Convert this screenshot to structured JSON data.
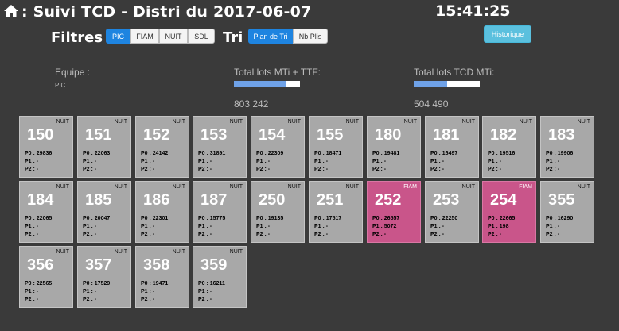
{
  "header": {
    "title": ": Suivi TCD - Distri du 2017-06-07",
    "clock": "15:41:25",
    "home_icon": "home-icon"
  },
  "filters": {
    "label": "Filtres",
    "options": [
      "PIC",
      "FIAM",
      "NUIT",
      "SDL"
    ],
    "active": "PIC"
  },
  "sort": {
    "label": "Tri",
    "options": [
      "Plan de Tri",
      "Nb Plis"
    ],
    "active": "Plan de Tri"
  },
  "historique_label": "Historique",
  "stats": {
    "equipe_label": "Equipe :",
    "equipe_value": "PIC",
    "total_mti_ttf_label": "Total lots MTi + TTF:",
    "total_mti_ttf_value": "803 242",
    "total_mti_ttf_progress": 0.8,
    "total_tcd_mti_label": "Total lots TCD MTi:",
    "total_tcd_mti_value": "504 490",
    "total_tcd_mti_progress": 0.5
  },
  "colors": {
    "background": "#3a3a3a",
    "tile_default": "#a8a8a8",
    "tile_fiam": "#c9558a",
    "accent_blue": "#1e84e0",
    "historique": "#5bc0de"
  },
  "tiles": [
    {
      "num": "150",
      "tag": "NUIT",
      "p0": "P0 : 29836",
      "p1": "P1 : -",
      "p2": "P2 : -"
    },
    {
      "num": "151",
      "tag": "NUIT",
      "p0": "P0 : 22063",
      "p1": "P1 : -",
      "p2": "P2 : -"
    },
    {
      "num": "152",
      "tag": "NUIT",
      "p0": "P0 : 24142",
      "p1": "P1 : -",
      "p2": "P2 : -"
    },
    {
      "num": "153",
      "tag": "NUIT",
      "p0": "P0 : 31891",
      "p1": "P1 : -",
      "p2": "P2 : -"
    },
    {
      "num": "154",
      "tag": "NUIT",
      "p0": "P0 : 22309",
      "p1": "P1 : -",
      "p2": "P2 : -"
    },
    {
      "num": "155",
      "tag": "NUIT",
      "p0": "P0 : 18471",
      "p1": "P1 : -",
      "p2": "P2 : -"
    },
    {
      "num": "180",
      "tag": "NUIT",
      "p0": "P0 : 19481",
      "p1": "P1 : -",
      "p2": "P2 : -"
    },
    {
      "num": "181",
      "tag": "NUIT",
      "p0": "P0 : 16497",
      "p1": "P1 : -",
      "p2": "P2 : -"
    },
    {
      "num": "182",
      "tag": "NUIT",
      "p0": "P0 : 19516",
      "p1": "P1 : -",
      "p2": "P2 : -"
    },
    {
      "num": "183",
      "tag": "NUIT",
      "p0": "P0 : 19906",
      "p1": "P1 : -",
      "p2": "P2 : -"
    },
    {
      "num": "184",
      "tag": "NUIT",
      "p0": "P0 : 22065",
      "p1": "P1 : -",
      "p2": "P2 : -"
    },
    {
      "num": "185",
      "tag": "NUIT",
      "p0": "P0 : 20047",
      "p1": "P1 : -",
      "p2": "P2 : -"
    },
    {
      "num": "186",
      "tag": "NUIT",
      "p0": "P0 : 22301",
      "p1": "P1 : -",
      "p2": "P2 : -"
    },
    {
      "num": "187",
      "tag": "NUIT",
      "p0": "P0 : 15775",
      "p1": "P1 : -",
      "p2": "P2 : -"
    },
    {
      "num": "250",
      "tag": "NUIT",
      "p0": "P0 : 19135",
      "p1": "P1 : -",
      "p2": "P2 : -"
    },
    {
      "num": "251",
      "tag": "NUIT",
      "p0": "P0 : 17517",
      "p1": "P1 : -",
      "p2": "P2 : -"
    },
    {
      "num": "252",
      "tag": "FIAM",
      "p0": "P0 : 26557",
      "p1": "P1 : 5072",
      "p2": "P2 : -",
      "fiam": true
    },
    {
      "num": "253",
      "tag": "NUIT",
      "p0": "P0 : 22250",
      "p1": "P1 : -",
      "p2": "P2 : -"
    },
    {
      "num": "254",
      "tag": "FIAM",
      "p0": "P0 : 22665",
      "p1": "P1 : 198",
      "p2": "P2 : -",
      "fiam": true
    },
    {
      "num": "355",
      "tag": "NUIT",
      "p0": "P0 : 16290",
      "p1": "P1 : -",
      "p2": "P2 : -"
    },
    {
      "num": "356",
      "tag": "NUIT",
      "p0": "P0 : 22565",
      "p1": "P1 : -",
      "p2": "P2 : -"
    },
    {
      "num": "357",
      "tag": "NUIT",
      "p0": "P0 : 17529",
      "p1": "P1 : -",
      "p2": "P2 : -"
    },
    {
      "num": "358",
      "tag": "NUIT",
      "p0": "P0 : 19471",
      "p1": "P1 : -",
      "p2": "P2 : -"
    },
    {
      "num": "359",
      "tag": "NUIT",
      "p0": "P0 : 16211",
      "p1": "P1 : -",
      "p2": "P2 : -"
    }
  ]
}
